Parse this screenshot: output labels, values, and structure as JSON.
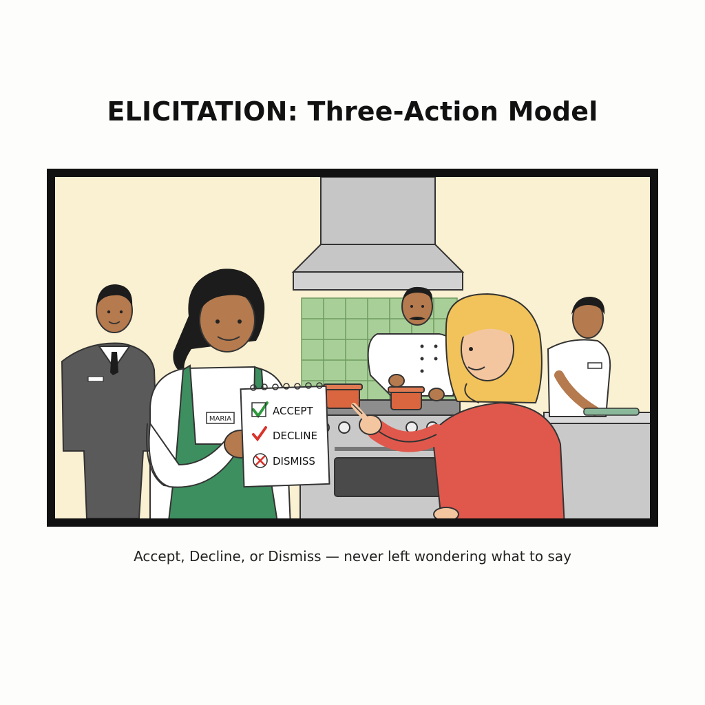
{
  "title": "ELICITATION: Three-Action Model",
  "caption": "Accept, Decline, or Dismiss — never left wondering what to say",
  "illustration": {
    "name_tag": "MARIA",
    "notepad": {
      "options": [
        {
          "label": "ACCEPT",
          "icon": "check-icon",
          "color": "#2e9a3e"
        },
        {
          "label": "DECLINE",
          "icon": "check-icon",
          "color": "#d8342c"
        },
        {
          "label": "DISMISS",
          "icon": "x-circle-icon",
          "color": "#d8342c"
        }
      ]
    },
    "colors": {
      "wall": "#faf0d2",
      "tiles": "#a8cf98",
      "apron": "#3e8f5f",
      "sweater": "#e0584c",
      "hair_blonde": "#f1c35a",
      "suit": "#5a5a5a",
      "steel": "#c4c4c4",
      "pot": "#d9663e"
    }
  }
}
